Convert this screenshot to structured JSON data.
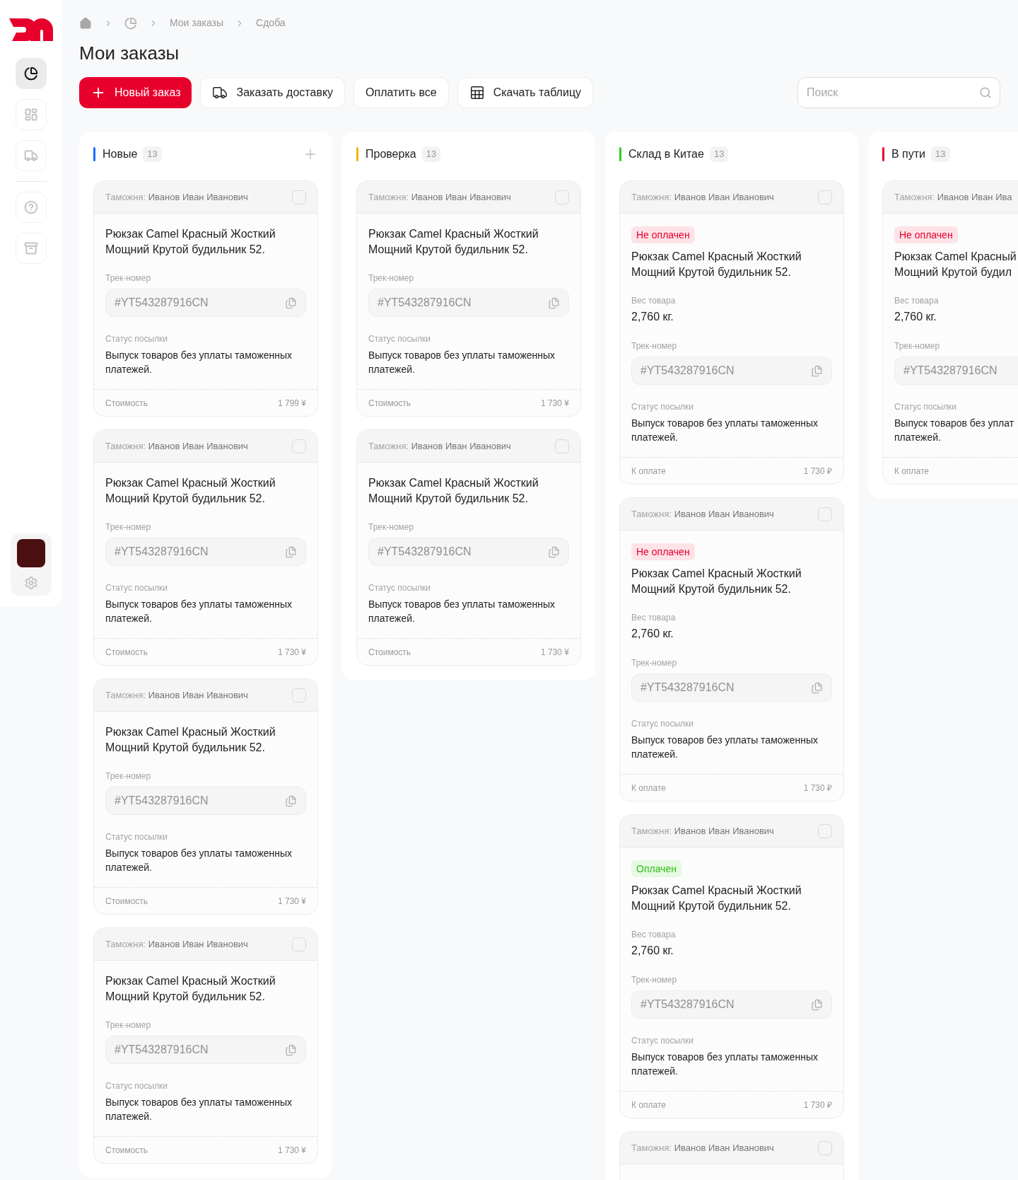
{
  "sidebar": {
    "items": [
      {
        "kind": "pie",
        "selected": true
      },
      {
        "kind": "dashboard",
        "selected": false
      },
      {
        "kind": "truck",
        "selected": false
      },
      {
        "kind": "divider"
      },
      {
        "kind": "help",
        "selected": false
      },
      {
        "kind": "archive",
        "selected": false
      }
    ]
  },
  "breadcrumbs": [
    {
      "kind": "home"
    },
    {
      "kind": "pie"
    },
    {
      "kind": "text",
      "label": "Мои заказы"
    },
    {
      "kind": "text",
      "label": "Сдоба"
    }
  ],
  "title": "Мои заказы",
  "toolbar": [
    {
      "kind": "new",
      "label": "Новый заказ"
    },
    {
      "kind": "delivery",
      "label": "Заказать доставку"
    },
    {
      "kind": "pay",
      "label": "Оплатить все"
    },
    {
      "kind": "download",
      "label": "Скачать таблицу"
    }
  ],
  "search": {
    "placeholder": "Поиск"
  },
  "columns": [
    {
      "title": "Новые",
      "count": "13",
      "color": "#1a6dff",
      "add_button": true,
      "cards": [
        {
          "kind": "full",
          "customs_label": "Таможня:",
          "customs_name": "Иванов Иван Иванович",
          "checked": false,
          "title": "Рюкзак Camel Красный Жосткий Мощний Крутой будильник 52.",
          "track_label": "Трек-номер",
          "track": "#YT543287916CN",
          "status_label": "Статус посылки",
          "status": "Выпуск товаров без уплаты таможенных платежей.",
          "footer_label": "Стоимость",
          "price": "1 799 ¥"
        },
        {
          "kind": "full",
          "customs_label": "Таможня:",
          "customs_name": "Иванов Иван Иванович",
          "checked": false,
          "title": "Рюкзак Camel Красный Жосткий Мощний Крутой будильник 52.",
          "track_label": "Трек-номер",
          "track": "#YT543287916CN",
          "status_label": "Статус посылки",
          "status": "Выпуск товаров без уплаты таможенных платежей.",
          "footer_label": "Стоимость",
          "price": "1 730 ¥"
        },
        {
          "kind": "full",
          "customs_label": "Таможня:",
          "customs_name": "Иванов Иван Иванович",
          "checked": false,
          "title": "Рюкзак Camel Красный Жосткий Мощний Крутой будильник 52.",
          "track_label": "Трек-номер",
          "track": "#YT543287916CN",
          "status_label": "Статус посылки",
          "status": "Выпуск товаров без уплаты таможенных платежей.",
          "footer_label": "Стоимость",
          "price": "1 730 ¥"
        },
        {
          "kind": "full",
          "customs_label": "Таможня:",
          "customs_name": "Иванов Иван Иванович",
          "checked": false,
          "title": "Рюкзак Camel Красный Жосткий Мощний Крутой будильник 52.",
          "track_label": "Трек-номер",
          "track": "#YT543287916CN",
          "status_label": "Статус посылки",
          "status": "Выпуск товаров без уплаты таможенных платежей.",
          "footer_label": "Стоимость",
          "price": "1 730 ¥"
        }
      ]
    },
    {
      "title": "Проверка",
      "count": "13",
      "color": "#f5b400",
      "add_button": false,
      "cards": [
        {
          "kind": "full",
          "customs_label": "Таможня:",
          "customs_name": "Иванов Иван Иванович",
          "checked": false,
          "title": "Рюкзак Camel Красный Жосткий Мощний Крутой будильник 52.",
          "track_label": "Трек-номер",
          "track": "#YT543287916CN",
          "status_label": "Статус посылки",
          "status": "Выпуск товаров без уплаты таможенных платежей.",
          "footer_label": "Стоимость",
          "price": "1 730 ¥"
        },
        {
          "kind": "full",
          "customs_label": "Таможня:",
          "customs_name": "Иванов Иван Иванович",
          "checked": false,
          "title": "Рюкзак Camel Красный Жосткий Мощний Крутой будильник 52.",
          "track_label": "Трек-номер",
          "track": "#YT543287916CN",
          "status_label": "Статус посылки",
          "status": "Выпуск товаров без уплаты таможенных платежей.",
          "footer_label": "Стоимость",
          "price": "1 730 ¥"
        }
      ]
    },
    {
      "title": "Склад в Китае",
      "count": "13",
      "color": "#33cc22",
      "add_button": false,
      "cards": [
        {
          "kind": "full",
          "customs_label": "Таможня:",
          "customs_name": "Иванов Иван Иванович",
          "checked": false,
          "badge": {
            "kind": "unpaid",
            "label": "Не оплачен"
          },
          "title": "Рюкзак Camel Красный Жосткий Мощний Крутой будильник 52.",
          "weight_label": "Вес товара",
          "weight": "2,760 кг.",
          "track_label": "Трек-номер",
          "track": "#YT543287916CN",
          "status_label": "Статус посылки",
          "status": "Выпуск товаров без уплаты таможенных платежей.",
          "footer_label": "К оплате",
          "price": "1 730 ₽"
        },
        {
          "kind": "full",
          "customs_label": "Таможня:",
          "customs_name": "Иванов Иван Иванович",
          "checked": false,
          "badge": {
            "kind": "unpaid",
            "label": "Не оплачен"
          },
          "title": "Рюкзак Camel Красный Жосткий Мощний Крутой будильник 52.",
          "weight_label": "Вес товара",
          "weight": "2,760 кг.",
          "track_label": "Трек-номер",
          "track": "#YT543287916CN",
          "status_label": "Статус посылки",
          "status": "Выпуск товаров без уплаты таможенных платежей.",
          "footer_label": "К оплате",
          "price": "1 730 ₽"
        },
        {
          "kind": "full",
          "customs_label": "Таможня:",
          "customs_name": "Иванов Иван Иванович",
          "checked": false,
          "badge": {
            "kind": "paid",
            "label": "Оплачен"
          },
          "title": "Рюкзак Camel Красный Жосткий Мощний Крутой будильник 52.",
          "weight_label": "Вес товара",
          "weight": "2,760 кг.",
          "track_label": "Трек-номер",
          "track": "#YT543287916CN",
          "status_label": "Статус посылки",
          "status": "Выпуск товаров без уплаты таможенных платежей.",
          "footer_label": "К оплате",
          "price": "1 730 ₽"
        },
        {
          "kind": "header_only",
          "customs_label": "Таможня:",
          "customs_name": "Иванов Иван Иванович",
          "checked": false
        }
      ]
    },
    {
      "title": "В пути",
      "count": "13",
      "color": "#e8002d",
      "add_button": false,
      "cards": [
        {
          "kind": "full",
          "customs_label": "Таможня:",
          "customs_name": "Иванов Иван Ива",
          "badge": {
            "kind": "unpaid",
            "label": "Не оплачен"
          },
          "title": "Рюкзак Camel Красный\nМощний Крутой будил",
          "weight_label": "Вес товара",
          "weight": "2,760 кг.",
          "track_label": "Трек-номер",
          "track": "#YT543287916CN",
          "status_label": "Статус посылки",
          "status": "Выпуск товаров без уплат\nплатежей.",
          "footer_label": "К оплате"
        }
      ]
    }
  ]
}
